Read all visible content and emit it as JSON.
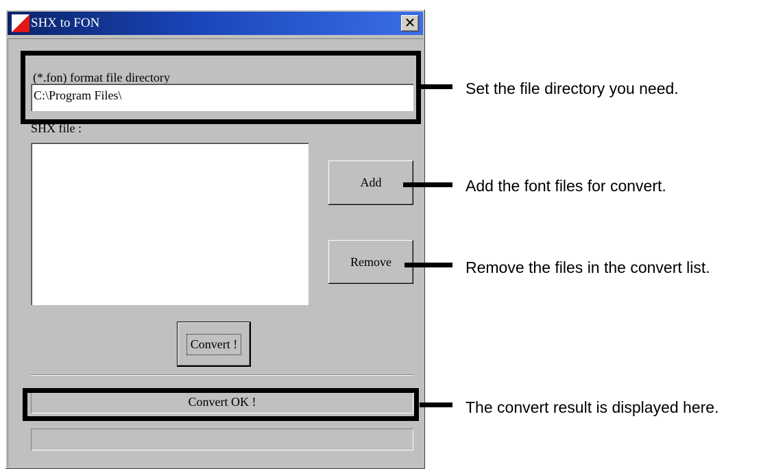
{
  "window": {
    "title": "SHX to FON",
    "close_glyph": "✕"
  },
  "form": {
    "directory_label": "(*.fon) format file directory",
    "directory_value": "C:\\Program Files\\",
    "shx_label": "SHX file :",
    "shx_list_items": [],
    "add_button": "Add",
    "remove_button": "Remove",
    "convert_button": "Convert !",
    "status_text": "Convert OK !",
    "status_text_2": ""
  },
  "annotations": {
    "directory": "Set the file directory you need.",
    "add": "Add the font files for convert.",
    "remove": "Remove the files in the convert list.",
    "result": "The convert result is displayed here."
  },
  "icons": {
    "app": "shx-to-fon-app-icon",
    "close": "close-icon"
  },
  "colors": {
    "titlebar_start": "#0a246a",
    "titlebar_end": "#3a6ee8",
    "window_face": "#c0c0c0",
    "highlight_border": "#000000",
    "app_icon_red": "#e01818"
  }
}
